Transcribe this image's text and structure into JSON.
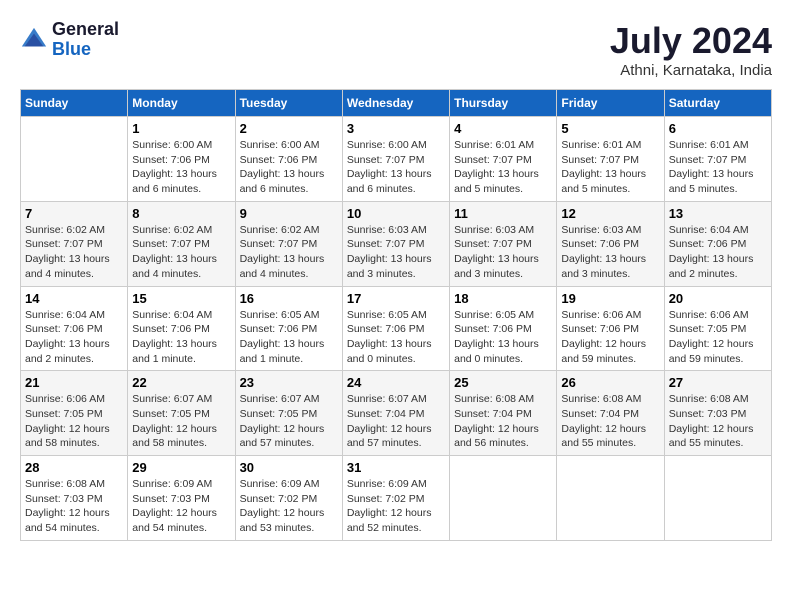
{
  "header": {
    "logo_line1": "General",
    "logo_line2": "Blue",
    "month": "July 2024",
    "location": "Athni, Karnataka, India"
  },
  "days_of_week": [
    "Sunday",
    "Monday",
    "Tuesday",
    "Wednesday",
    "Thursday",
    "Friday",
    "Saturday"
  ],
  "weeks": [
    [
      {
        "day": "",
        "info": ""
      },
      {
        "day": "1",
        "info": "Sunrise: 6:00 AM\nSunset: 7:06 PM\nDaylight: 13 hours\nand 6 minutes."
      },
      {
        "day": "2",
        "info": "Sunrise: 6:00 AM\nSunset: 7:06 PM\nDaylight: 13 hours\nand 6 minutes."
      },
      {
        "day": "3",
        "info": "Sunrise: 6:00 AM\nSunset: 7:07 PM\nDaylight: 13 hours\nand 6 minutes."
      },
      {
        "day": "4",
        "info": "Sunrise: 6:01 AM\nSunset: 7:07 PM\nDaylight: 13 hours\nand 5 minutes."
      },
      {
        "day": "5",
        "info": "Sunrise: 6:01 AM\nSunset: 7:07 PM\nDaylight: 13 hours\nand 5 minutes."
      },
      {
        "day": "6",
        "info": "Sunrise: 6:01 AM\nSunset: 7:07 PM\nDaylight: 13 hours\nand 5 minutes."
      }
    ],
    [
      {
        "day": "7",
        "info": "Sunrise: 6:02 AM\nSunset: 7:07 PM\nDaylight: 13 hours\nand 4 minutes."
      },
      {
        "day": "8",
        "info": "Sunrise: 6:02 AM\nSunset: 7:07 PM\nDaylight: 13 hours\nand 4 minutes."
      },
      {
        "day": "9",
        "info": "Sunrise: 6:02 AM\nSunset: 7:07 PM\nDaylight: 13 hours\nand 4 minutes."
      },
      {
        "day": "10",
        "info": "Sunrise: 6:03 AM\nSunset: 7:07 PM\nDaylight: 13 hours\nand 3 minutes."
      },
      {
        "day": "11",
        "info": "Sunrise: 6:03 AM\nSunset: 7:07 PM\nDaylight: 13 hours\nand 3 minutes."
      },
      {
        "day": "12",
        "info": "Sunrise: 6:03 AM\nSunset: 7:06 PM\nDaylight: 13 hours\nand 3 minutes."
      },
      {
        "day": "13",
        "info": "Sunrise: 6:04 AM\nSunset: 7:06 PM\nDaylight: 13 hours\nand 2 minutes."
      }
    ],
    [
      {
        "day": "14",
        "info": "Sunrise: 6:04 AM\nSunset: 7:06 PM\nDaylight: 13 hours\nand 2 minutes."
      },
      {
        "day": "15",
        "info": "Sunrise: 6:04 AM\nSunset: 7:06 PM\nDaylight: 13 hours\nand 1 minute."
      },
      {
        "day": "16",
        "info": "Sunrise: 6:05 AM\nSunset: 7:06 PM\nDaylight: 13 hours\nand 1 minute."
      },
      {
        "day": "17",
        "info": "Sunrise: 6:05 AM\nSunset: 7:06 PM\nDaylight: 13 hours\nand 0 minutes."
      },
      {
        "day": "18",
        "info": "Sunrise: 6:05 AM\nSunset: 7:06 PM\nDaylight: 13 hours\nand 0 minutes."
      },
      {
        "day": "19",
        "info": "Sunrise: 6:06 AM\nSunset: 7:06 PM\nDaylight: 12 hours\nand 59 minutes."
      },
      {
        "day": "20",
        "info": "Sunrise: 6:06 AM\nSunset: 7:05 PM\nDaylight: 12 hours\nand 59 minutes."
      }
    ],
    [
      {
        "day": "21",
        "info": "Sunrise: 6:06 AM\nSunset: 7:05 PM\nDaylight: 12 hours\nand 58 minutes."
      },
      {
        "day": "22",
        "info": "Sunrise: 6:07 AM\nSunset: 7:05 PM\nDaylight: 12 hours\nand 58 minutes."
      },
      {
        "day": "23",
        "info": "Sunrise: 6:07 AM\nSunset: 7:05 PM\nDaylight: 12 hours\nand 57 minutes."
      },
      {
        "day": "24",
        "info": "Sunrise: 6:07 AM\nSunset: 7:04 PM\nDaylight: 12 hours\nand 57 minutes."
      },
      {
        "day": "25",
        "info": "Sunrise: 6:08 AM\nSunset: 7:04 PM\nDaylight: 12 hours\nand 56 minutes."
      },
      {
        "day": "26",
        "info": "Sunrise: 6:08 AM\nSunset: 7:04 PM\nDaylight: 12 hours\nand 55 minutes."
      },
      {
        "day": "27",
        "info": "Sunrise: 6:08 AM\nSunset: 7:03 PM\nDaylight: 12 hours\nand 55 minutes."
      }
    ],
    [
      {
        "day": "28",
        "info": "Sunrise: 6:08 AM\nSunset: 7:03 PM\nDaylight: 12 hours\nand 54 minutes."
      },
      {
        "day": "29",
        "info": "Sunrise: 6:09 AM\nSunset: 7:03 PM\nDaylight: 12 hours\nand 54 minutes."
      },
      {
        "day": "30",
        "info": "Sunrise: 6:09 AM\nSunset: 7:02 PM\nDaylight: 12 hours\nand 53 minutes."
      },
      {
        "day": "31",
        "info": "Sunrise: 6:09 AM\nSunset: 7:02 PM\nDaylight: 12 hours\nand 52 minutes."
      },
      {
        "day": "",
        "info": ""
      },
      {
        "day": "",
        "info": ""
      },
      {
        "day": "",
        "info": ""
      }
    ]
  ]
}
